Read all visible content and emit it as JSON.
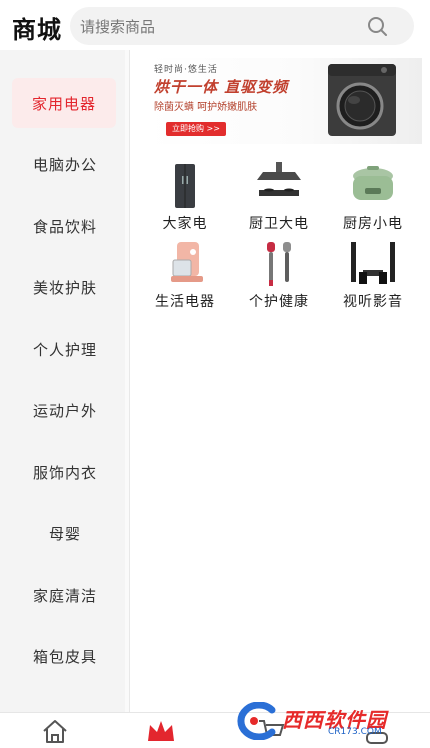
{
  "header": {
    "title": "商城",
    "search_placeholder": "请搜索商品"
  },
  "sidebar": {
    "items": [
      {
        "label": "家用电器",
        "active": true
      },
      {
        "label": "电脑办公"
      },
      {
        "label": "食品饮料"
      },
      {
        "label": "美妆护肤"
      },
      {
        "label": "个人护理"
      },
      {
        "label": "运动户外"
      },
      {
        "label": "服饰内衣"
      },
      {
        "label": "母婴"
      },
      {
        "label": "家庭清洁"
      },
      {
        "label": "箱包皮具"
      }
    ]
  },
  "banner": {
    "small_text": "轻时尚·悠生活",
    "headline": "烘干一体 直驱变频",
    "subline": "除菌灭螨 呵护娇嫩肌肤",
    "button": "立即抢购 >>"
  },
  "products": [
    {
      "label": "大家电",
      "icon": "refrigerator-icon"
    },
    {
      "label": "厨卫大电",
      "icon": "range-hood-icon"
    },
    {
      "label": "厨房小电",
      "icon": "rice-cooker-icon"
    },
    {
      "label": "生活电器",
      "icon": "coffee-maker-icon"
    },
    {
      "label": "个护健康",
      "icon": "hair-dryer-icon"
    },
    {
      "label": "视听影音",
      "icon": "speaker-system-icon"
    }
  ],
  "bottom_nav": {
    "items": [
      {
        "icon": "home-icon"
      },
      {
        "icon": "crown-icon",
        "active": true
      },
      {
        "icon": "cart-icon"
      },
      {
        "icon": "profile-icon"
      }
    ]
  },
  "watermark": {
    "text": "西西软件园",
    "url": "CR173.COM"
  },
  "colors": {
    "accent": "#e3262e",
    "active_bg": "#fcebeb",
    "sidebar_bg": "#f4f4f4"
  }
}
